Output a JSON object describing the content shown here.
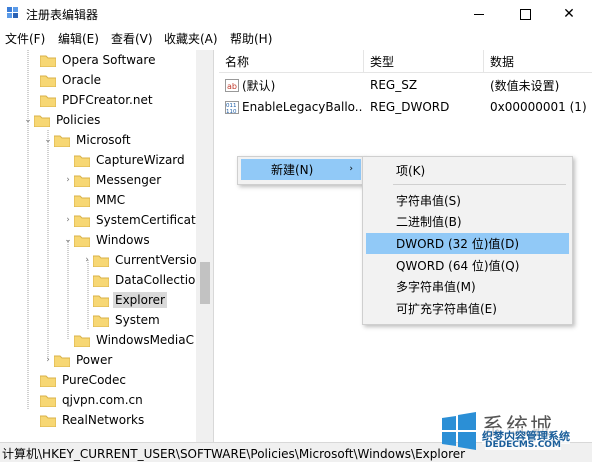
{
  "window": {
    "title": "注册表编辑器",
    "minimize_icon": "minimize-icon",
    "maximize_icon": "maximize-icon",
    "close_icon": "close-icon",
    "close_glyph": "✕"
  },
  "menubar": {
    "items": [
      "文件(F)",
      "编辑(E)",
      "查看(V)",
      "收藏夹(A)",
      "帮助(H)"
    ]
  },
  "tree": {
    "items": [
      {
        "label": "Opera Software"
      },
      {
        "label": "Oracle"
      },
      {
        "label": "PDFCreator.net"
      },
      {
        "label": "Policies"
      },
      {
        "label": "Microsoft"
      },
      {
        "label": "CaptureWizard"
      },
      {
        "label": "Messenger"
      },
      {
        "label": "MMC"
      },
      {
        "label": "SystemCertificate"
      },
      {
        "label": "Windows"
      },
      {
        "label": "CurrentVersio"
      },
      {
        "label": "DataCollectio"
      },
      {
        "label": "Explorer"
      },
      {
        "label": "System"
      },
      {
        "label": "WindowsMediaC"
      },
      {
        "label": "Power"
      },
      {
        "label": "PureCodec"
      },
      {
        "label": "qjvpn.com.cn"
      },
      {
        "label": "RealNetworks"
      }
    ]
  },
  "list": {
    "columns": [
      "名称",
      "类型",
      "数据"
    ],
    "rows": [
      {
        "name": "(默认)",
        "type": "REG_SZ",
        "data": "(数值未设置)"
      },
      {
        "name": "EnableLegacyBallo...",
        "type": "REG_DWORD",
        "data": "0x00000001 (1)"
      }
    ]
  },
  "context_menu": {
    "new_label": "新建(N)",
    "arrow": "›",
    "submenu": [
      "项(K)",
      "字符串值(S)",
      "二进制值(B)",
      "DWORD (32 位)值(D)",
      "QWORD (64 位)值(Q)",
      "多字符串值(M)",
      "可扩充字符串值(E)"
    ]
  },
  "statusbar": {
    "path": "计算机\\HKEY_CURRENT_USER\\SOFTWARE\\Policies\\Microsoft\\Windows\\Explorer"
  },
  "watermark": {
    "brand": "系统城",
    "site": "织梦内容管理系统",
    "domain": "DEDECMS.COM"
  },
  "colors": {
    "highlight": "#91c9f7",
    "folder": "#f7d774",
    "selected": "#d9d9d9"
  }
}
